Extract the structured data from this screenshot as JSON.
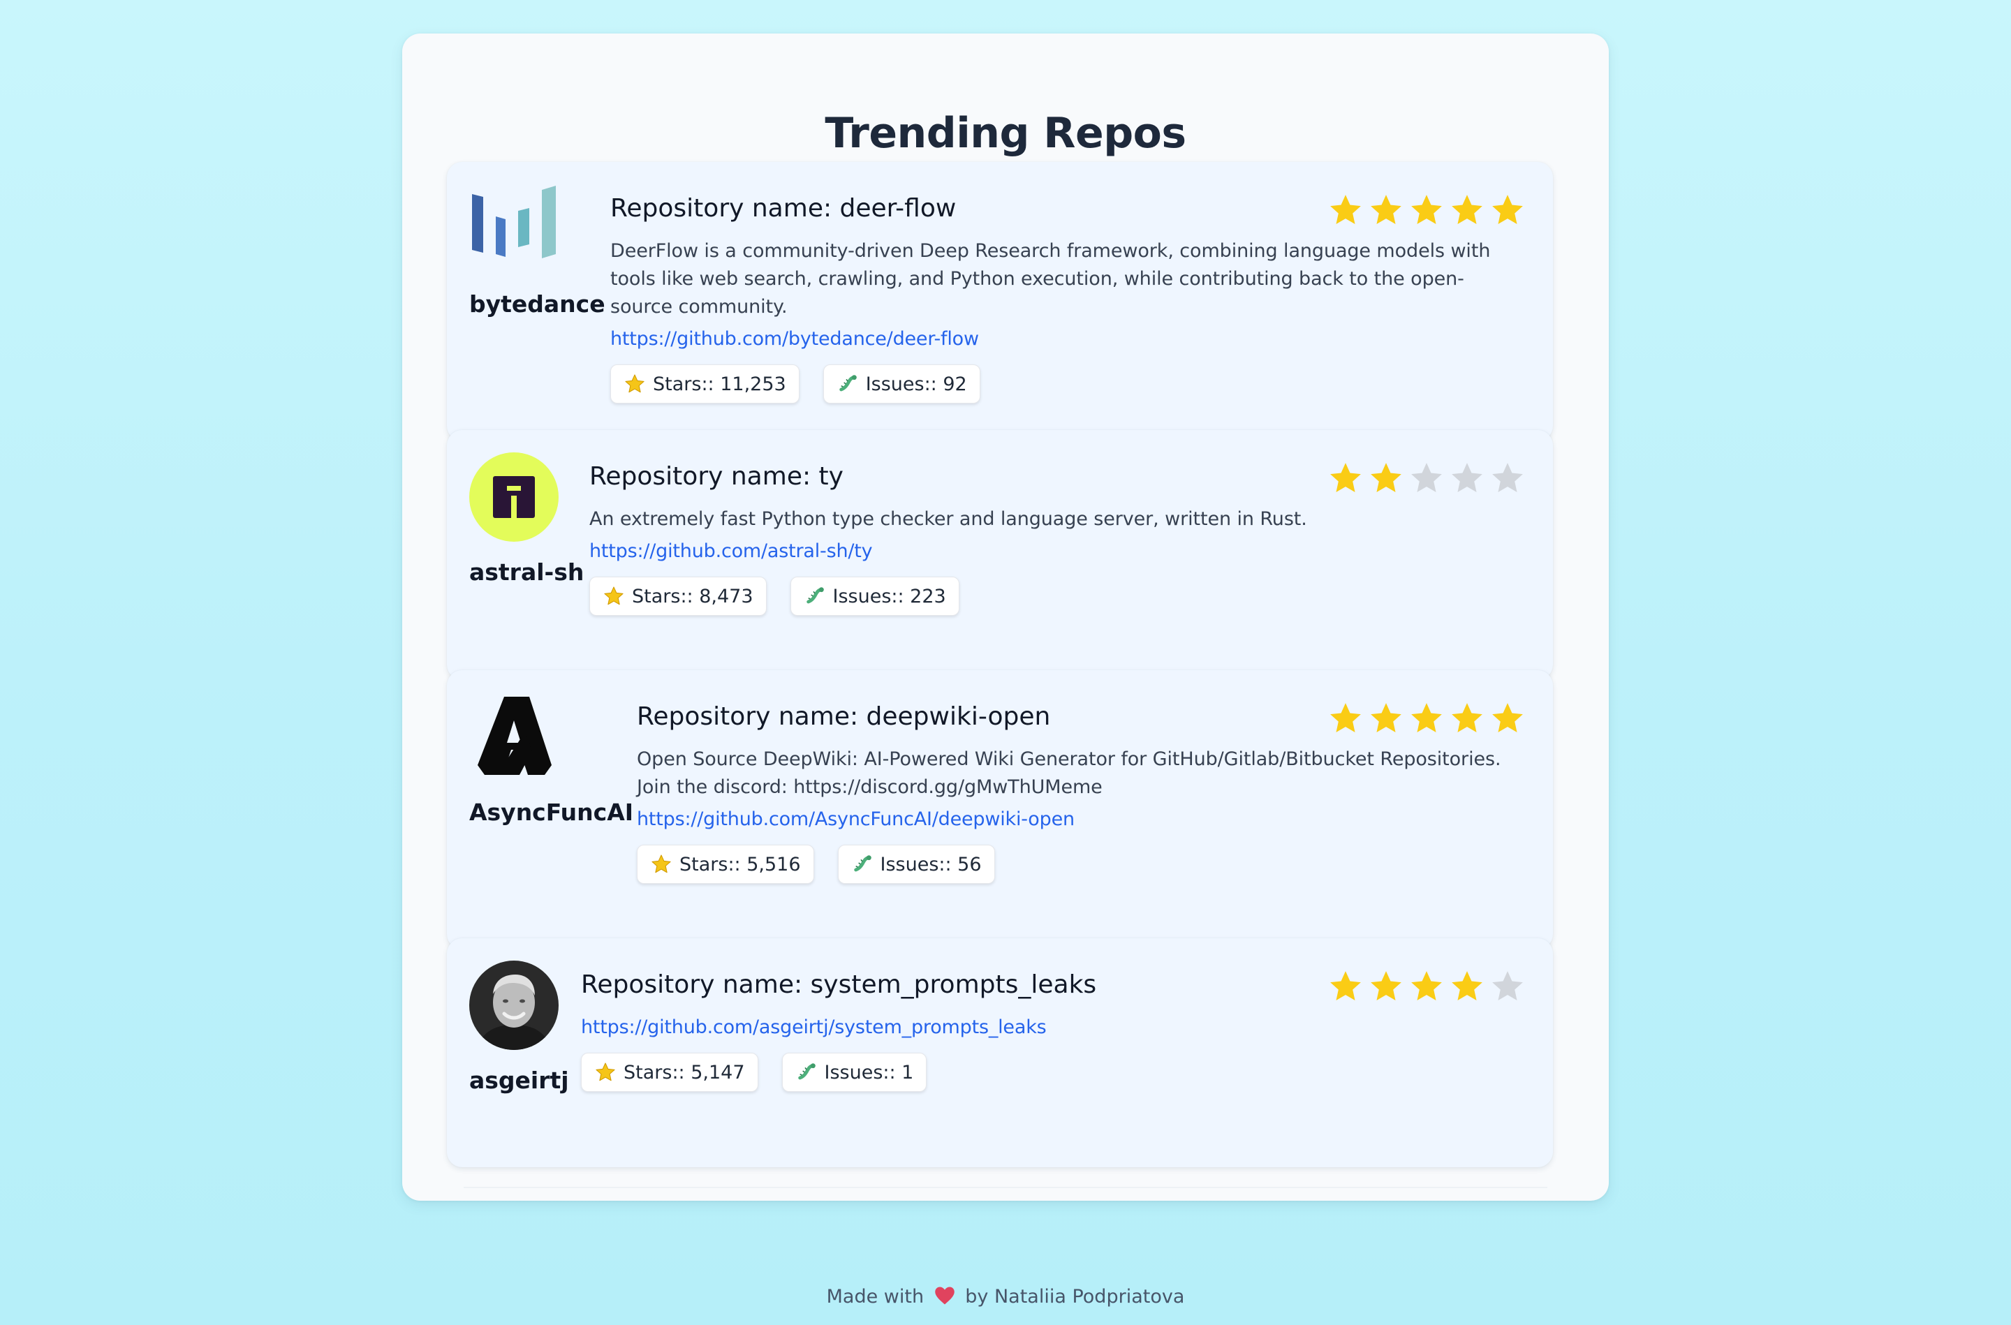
{
  "page": {
    "title": "Trending Repos"
  },
  "repos": [
    {
      "owner": "bytedance",
      "title": "Repository name: deer-flow",
      "description": "DeerFlow is a community-driven Deep Research framework, combining language models with tools like web search, crawling, and Python execution, while contributing back to the open-source community.",
      "url": "https://github.com/bytedance/deer-flow",
      "stars_label": "Stars:: 11,253",
      "issues_label": "Issues:: 92",
      "rating": 5,
      "logo_icon": "bytedance-logo-icon"
    },
    {
      "owner": "astral-sh",
      "title": "Repository name: ty",
      "description": "An extremely fast Python type checker and language server, written in Rust.",
      "url": "https://github.com/astral-sh/ty",
      "stars_label": "Stars:: 8,473",
      "issues_label": "Issues:: 223",
      "rating": 2,
      "logo_icon": "astral-logo-icon"
    },
    {
      "owner": "AsyncFuncAI",
      "title": "Repository name: deepwiki-open",
      "description": "Open Source DeepWiki: AI-Powered Wiki Generator for GitHub/Gitlab/Bitbucket Repositories. Join the discord: https://discord.gg/gMwThUMeme",
      "url": "https://github.com/AsyncFuncAI/deepwiki-open",
      "stars_label": "Stars:: 5,516",
      "issues_label": "Issues:: 56",
      "rating": 5,
      "logo_icon": "asyncfuncai-logo-icon"
    },
    {
      "owner": "asgeirtj",
      "title": "Repository name: system_prompts_leaks",
      "description": "",
      "url": "https://github.com/asgeirtj/system_prompts_leaks",
      "stars_label": "Stars:: 5,147",
      "issues_label": "Issues:: 1",
      "rating": 4,
      "logo_icon": "avatar-photo-icon"
    }
  ],
  "footer": {
    "prefix": "Made with",
    "suffix": "by Nataliia Podpriatova",
    "icon": "heart-icon"
  },
  "colors": {
    "star_filled": "#facc15",
    "star_empty": "#d1d5db",
    "link": "#2563eb",
    "card_bg": "#eff6ff",
    "page_bg": "#c2f3fb"
  }
}
